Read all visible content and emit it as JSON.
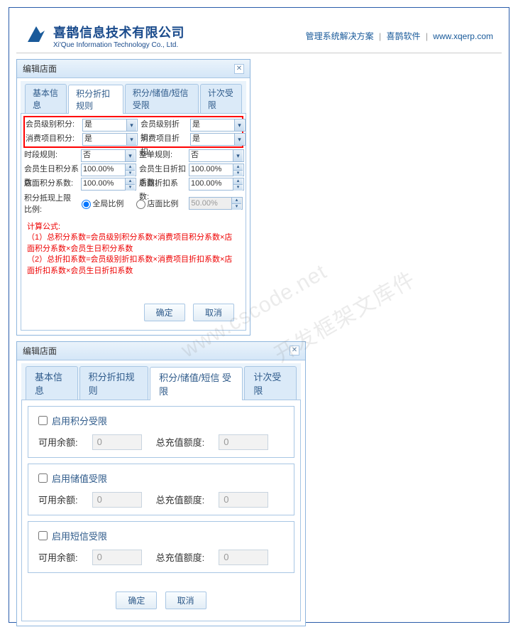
{
  "header": {
    "company_cn": "喜鹊信息技术有限公司",
    "company_en": "Xi'Que Information Technology Co., Ltd.",
    "links": [
      "管理系统解决方案",
      "喜鹊软件",
      "www.xqerp.com"
    ]
  },
  "dialog1": {
    "title": "编辑店面",
    "tabs": [
      "基本信息",
      "积分折扣规则",
      "积分/储值/短信 受限",
      "计次受限"
    ],
    "rows": [
      {
        "l1": "会员级别积分:",
        "v1": "是",
        "l2": "会员级别折扣:",
        "v2": "是"
      },
      {
        "l1": "消费项目积分:",
        "v1": "是",
        "l2": "消费项目折扣:",
        "v2": "是"
      },
      {
        "l1": "时段规则:",
        "v1": "否",
        "l2": "整单规则:",
        "v2": "否"
      },
      {
        "l1": "会员生日积分系数:",
        "v1": "100.00%",
        "l2": "会员生日折扣系数:",
        "v2": "100.00%"
      },
      {
        "l1": "店面积分系数:",
        "v1": "100.00%",
        "l2": "店面折扣系数:",
        "v2": "100.00%"
      },
      {
        "l1": "积分抵现上限比例:",
        "opt1": "全局比例",
        "opt2": "店面比例",
        "v": "50.00%"
      }
    ],
    "formula": {
      "title": "计算公式:",
      "line1": "（1）总积分系数=会员级别积分系数×消费项目积分系数×店面积分系数×会员生日积分系数",
      "line2": "（2）总折扣系数=会员级别折扣系数×消费项目折扣系数×店面折扣系数×会员生日折扣系数"
    },
    "ok": "确定",
    "cancel": "取消"
  },
  "dialog2": {
    "title": "编辑店面",
    "tabs": [
      "基本信息",
      "积分折扣规则",
      "积分/储值/短信 受限",
      "计次受限"
    ],
    "sections": [
      {
        "title": "启用积分受限"
      },
      {
        "title": "启用储值受限"
      },
      {
        "title": "启用短信受限"
      }
    ],
    "labels": {
      "avail": "可用余额:",
      "total": "总充值额度:"
    },
    "zero": "0",
    "ok": "确定",
    "cancel": "取消"
  }
}
